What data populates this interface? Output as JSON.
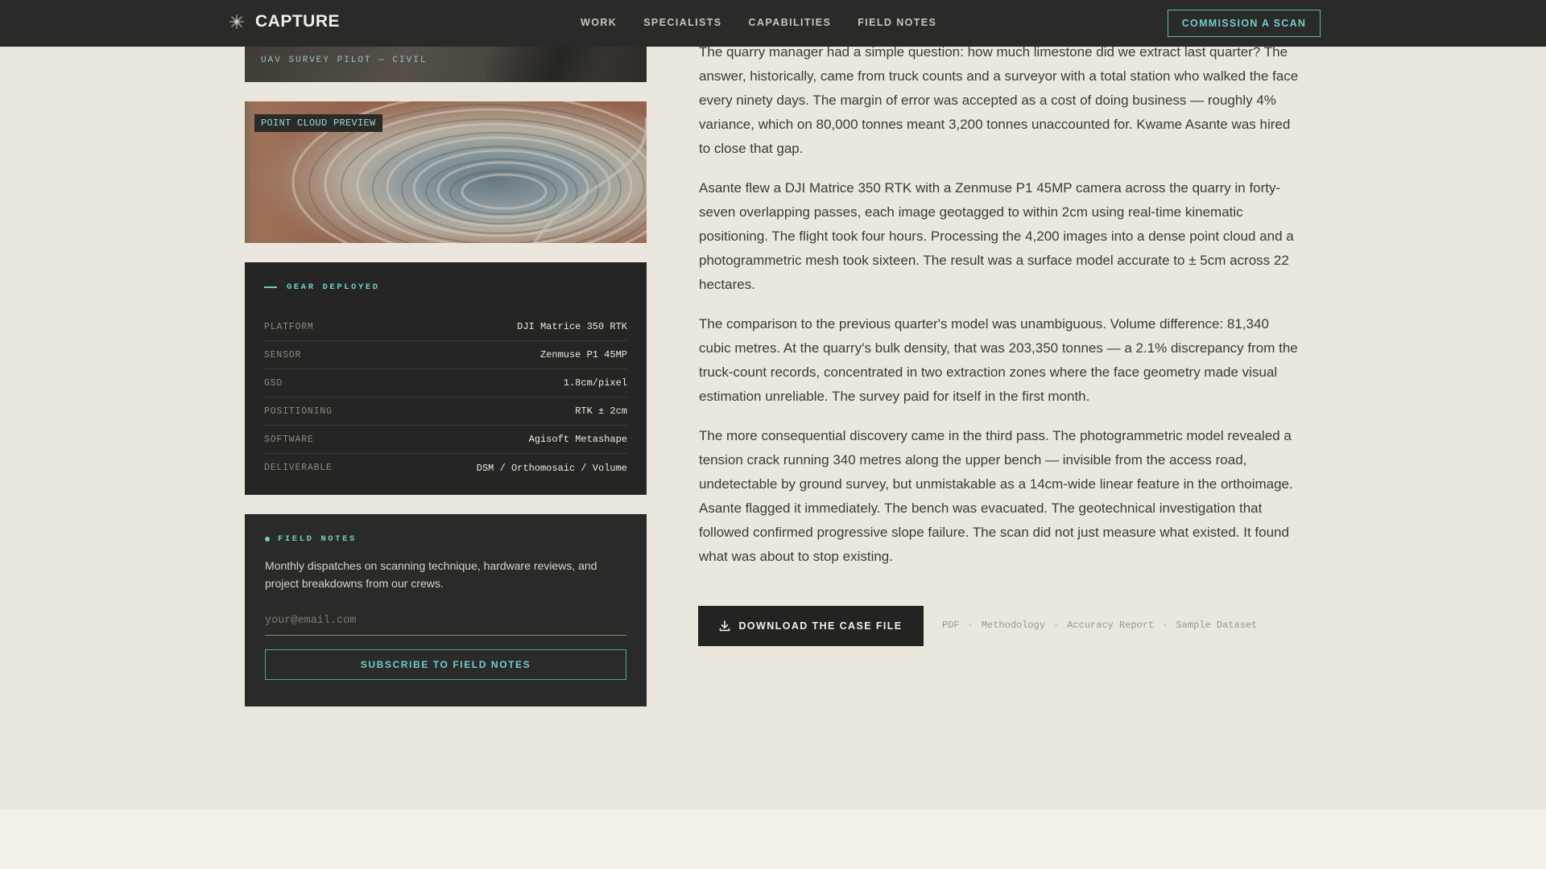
{
  "nav": {
    "brand": "CAPTURE",
    "links": [
      "WORK",
      "SPECIALISTS",
      "CAPABILITIES",
      "FIELD NOTES"
    ],
    "cta": "COMMISSION A SCAN",
    "accent": "#6fcfc9",
    "background": "#2a2a29"
  },
  "hero_image": {
    "caption": "UAV SURVEY PILOT — CIVIL"
  },
  "quarry_image": {
    "tag": "POINT CLOUD PREVIEW"
  },
  "gear": {
    "label": "GEAR DEPLOYED",
    "rows": [
      {
        "key": "PLATFORM",
        "value": "DJI Matrice 350 RTK"
      },
      {
        "key": "SENSOR",
        "value": "Zenmuse P1 45MP"
      },
      {
        "key": "GSD",
        "value": "1.8cm/pixel"
      },
      {
        "key": "POSITIONING",
        "value": "RTK ± 2cm"
      },
      {
        "key": "SOFTWARE",
        "value": "Agisoft Metashape"
      },
      {
        "key": "DELIVERABLE",
        "value": "DSM / Orthomosaic / Volume"
      }
    ]
  },
  "field_notes": {
    "label": "FIELD NOTES",
    "description": "Monthly dispatches on scanning technique, hardware reviews, and project breakdowns from our crews.",
    "email_placeholder": "your@email.com",
    "subscribe_label": "SUBSCRIBE TO FIELD NOTES"
  },
  "article": {
    "paragraphs": [
      "The quarry manager had a simple question: how much limestone did we extract last quarter? The answer, historically, came from truck counts and a surveyor with a total station who walked the face every ninety days. The margin of error was accepted as a cost of doing business — roughly 4% variance, which on 80,000 tonnes meant 3,200 tonnes unaccounted for. Kwame Asante was hired to close that gap.",
      "Asante flew a DJI Matrice 350 RTK with a Zenmuse P1 45MP camera across the quarry in forty-seven overlapping passes, each image geotagged to within 2cm using real-time kinematic positioning. The flight took four hours. Processing the 4,200 images into a dense point cloud and a photogrammetric mesh took sixteen. The result was a surface model accurate to ± 5cm across 22 hectares.",
      "The comparison to the previous quarter's model was unambiguous. Volume difference: 81,340 cubic metres. At the quarry's bulk density, that was 203,350 tonnes — a 2.1% discrepancy from the truck-count records, concentrated in two extraction zones where the face geometry made visual estimation unreliable. The survey paid for itself in the first month.",
      "The more consequential discovery came in the third pass. The photogrammetric model revealed a tension crack running 340 metres along the upper bench — invisible from the access road, undetectable by ground survey, but unmistakable as a 14cm-wide linear feature in the orthoimage. Asante flagged it immediately. The bench was evacuated. The geotechnical investigation that followed confirmed progressive slope failure. The scan did not just measure what existed. It found what was about to stop existing."
    ]
  },
  "download": {
    "label": "DOWNLOAD THE CASE FILE",
    "formats": [
      "PDF",
      "Methodology",
      "Accuracy Report",
      "Sample Dataset"
    ],
    "separator": "·"
  }
}
